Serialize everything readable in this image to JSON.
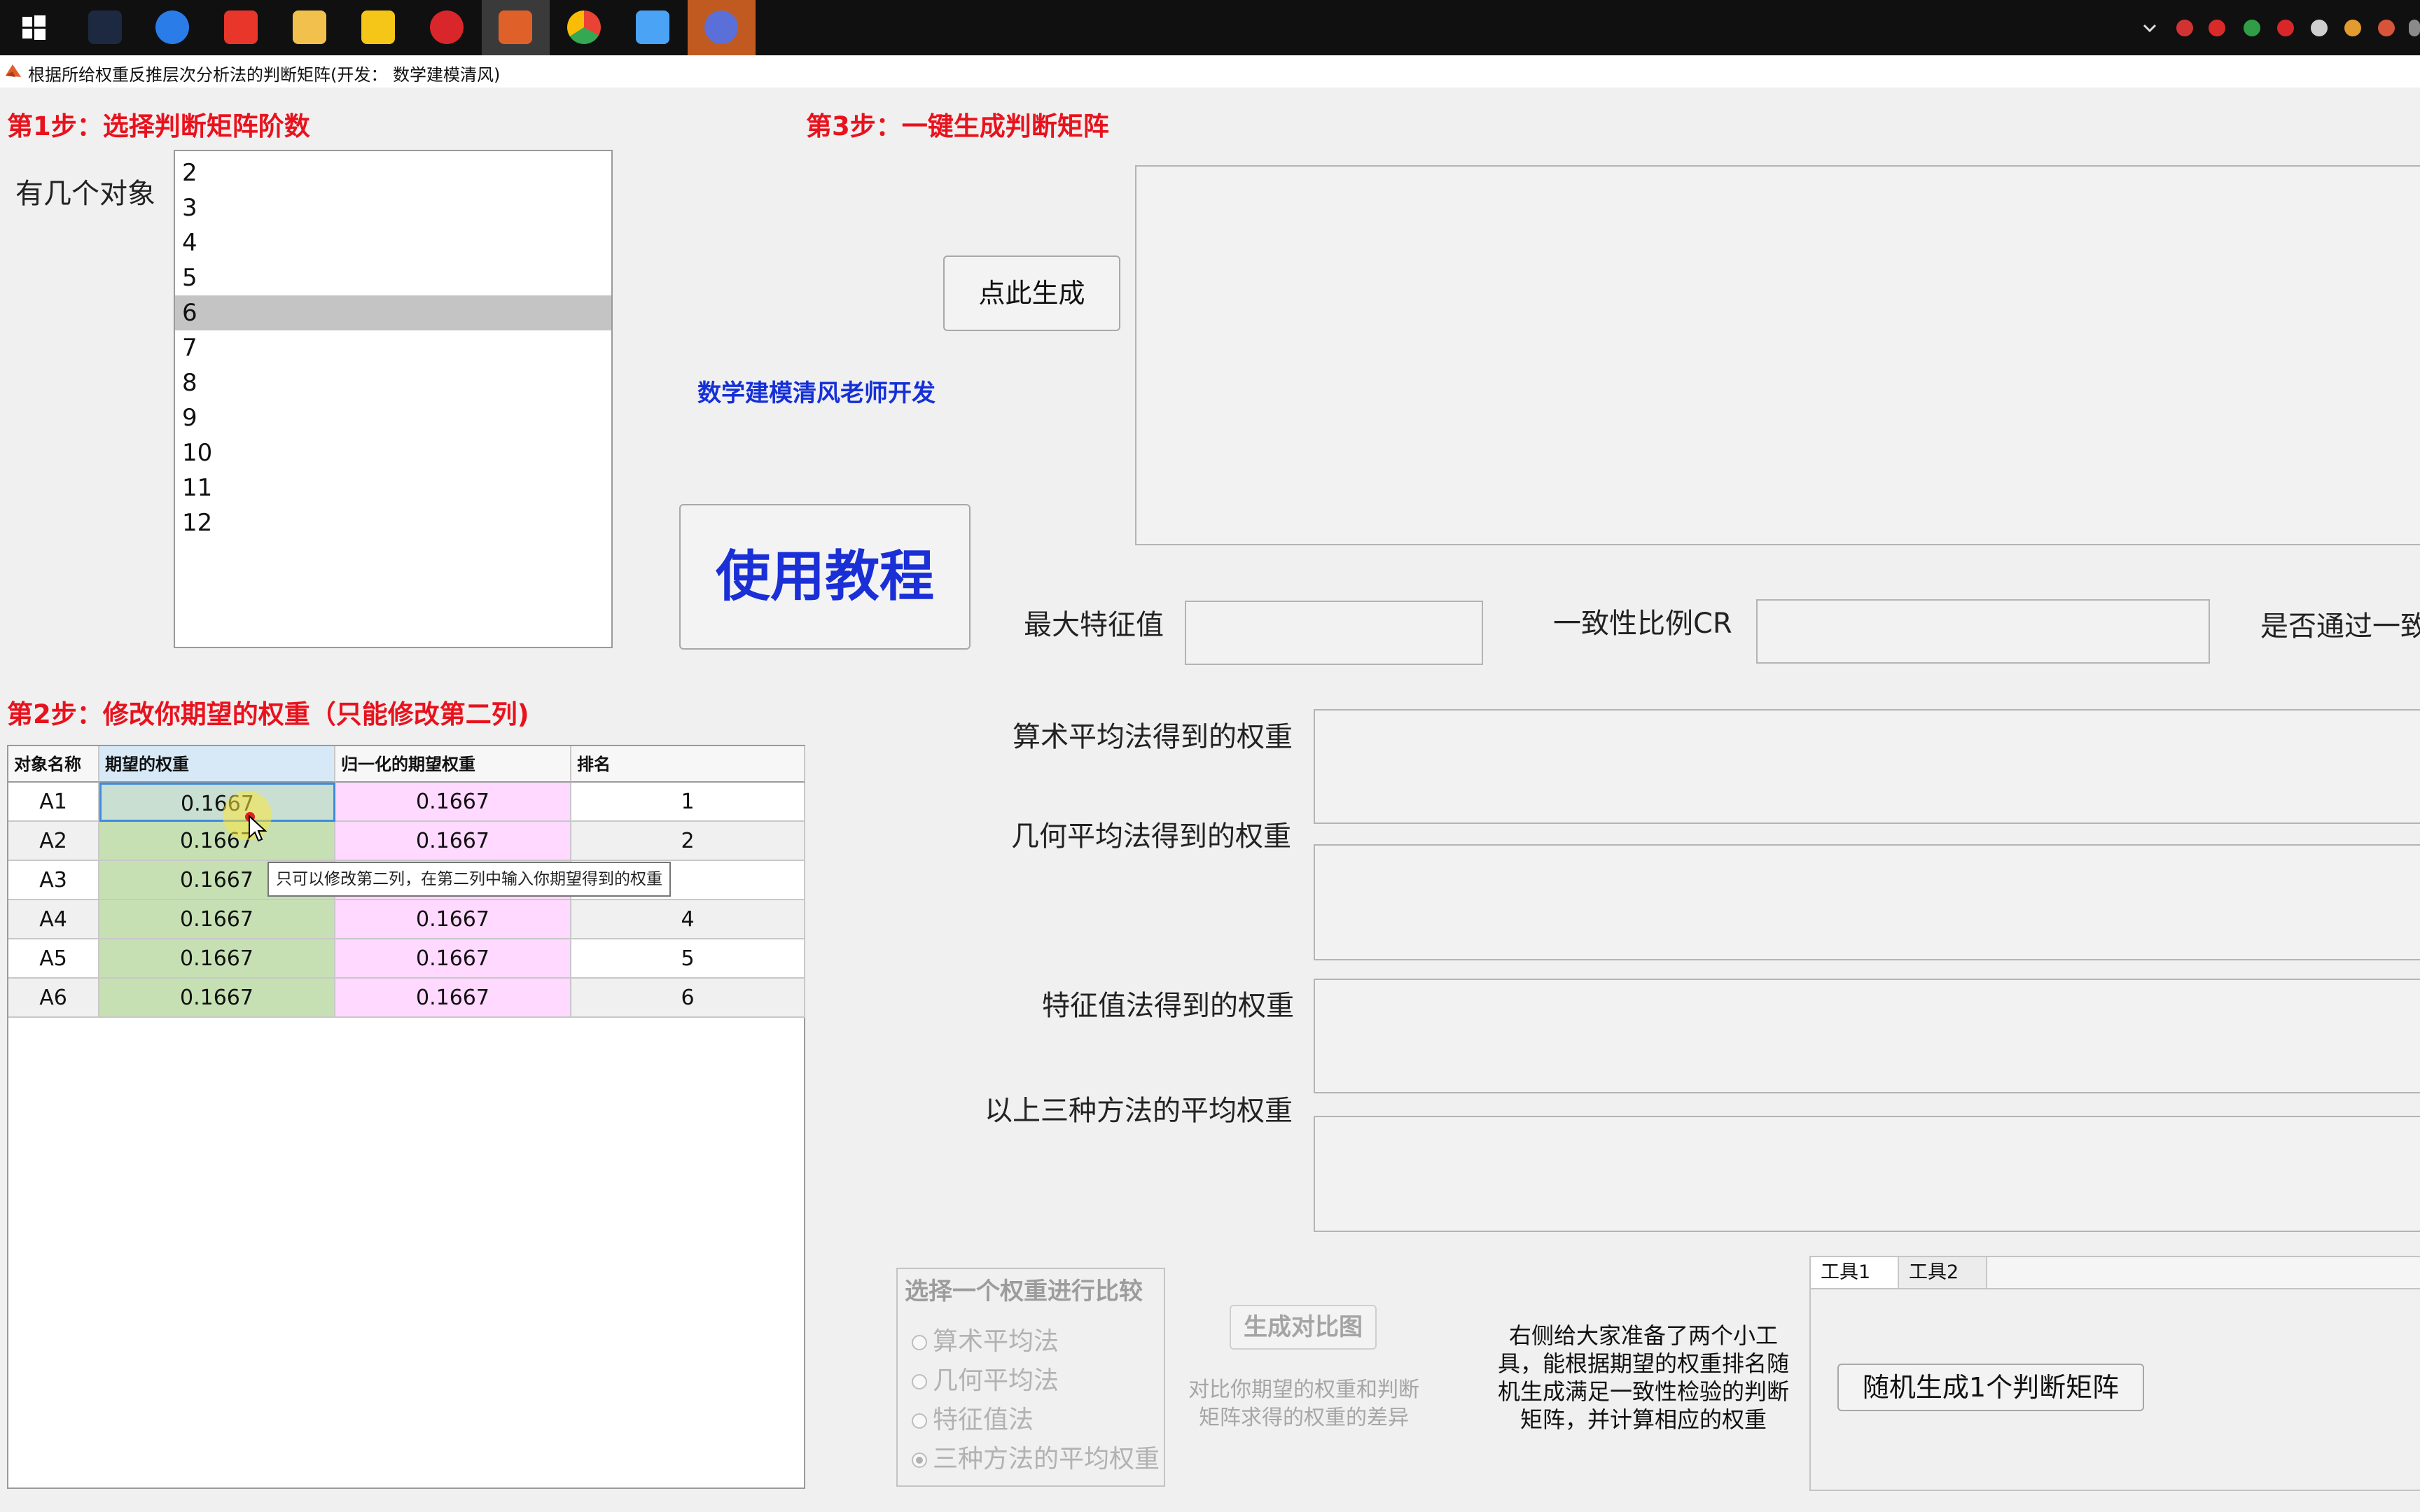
{
  "window": {
    "title": "根据所给权重反推层次分析法的判断矩阵(开发： 数学建模清风)"
  },
  "taskbar": {
    "apps": [
      "start-icon",
      "game-icon",
      "sogou-input-icon",
      "tingshu-app-icon",
      "file-explorer-icon",
      "folder-icon",
      "netease-music-icon",
      "matlab-icon",
      "chrome-icon",
      "baidu-netdisk-icon",
      "app-icon"
    ]
  },
  "step1": {
    "title": "第1步：选择判断矩阵阶数",
    "count_label": "有几个对象",
    "options": [
      "2",
      "3",
      "4",
      "5",
      "6",
      "7",
      "8",
      "9",
      "10",
      "11",
      "12"
    ],
    "selected": "6"
  },
  "step2": {
    "title": "第2步：修改你期望的权重（只能修改第二列)",
    "columns": [
      "对象名称",
      "期望的权重",
      "归一化的期望权重",
      "排名"
    ],
    "rows": [
      {
        "name": "A1",
        "weight": "0.1667",
        "normalized": "0.1667",
        "rank": "1"
      },
      {
        "name": "A2",
        "weight": "0.1667",
        "normalized": "0.1667",
        "rank": "2"
      },
      {
        "name": "A3",
        "weight": "0.1667",
        "normalized": "",
        "rank": ""
      },
      {
        "name": "A4",
        "weight": "0.1667",
        "normalized": "0.1667",
        "rank": "4"
      },
      {
        "name": "A5",
        "weight": "0.1667",
        "normalized": "0.1667",
        "rank": "5"
      },
      {
        "name": "A6",
        "weight": "0.1667",
        "normalized": "0.1667",
        "rank": "6"
      }
    ],
    "tooltip": "只可以修改第二列，在第二列中输入你期望得到的权重"
  },
  "step3": {
    "title": "第3步：一键生成判断矩阵",
    "generate_button": "点此生成",
    "developer_credit": "数学建模清风老师开发",
    "tutorial_button": "使用教程",
    "max_eigen_label": "最大特征值",
    "cr_label": "一致性比例CR",
    "pass_label": "是否通过一致"
  },
  "weights": {
    "arith_label": "算术平均法得到的权重",
    "geo_label": "几何平均法得到的权重",
    "eigen_label": "特征值法得到的权重",
    "avg_label": "以上三种方法的平均权重"
  },
  "compare": {
    "group_title": "选择一个权重进行比较",
    "options": [
      "算术平均法",
      "几何平均法",
      "特征值法",
      "三种方法的平均权重"
    ],
    "selected_index": 3,
    "button": "生成对比图",
    "note": "对比你期望的权重和判断矩阵求得的权重的差异"
  },
  "tools": {
    "intro": "右侧给大家准备了两个小工具，能根据期望的权重排名随机生成满足一致性检验的判断矩阵，并计算相应的权重",
    "tabs": [
      "工具1",
      "工具2"
    ],
    "random_button": "随机生成1个判断矩阵"
  },
  "colors": {
    "step_title": "#e8121d",
    "credit_blue": "#1530d8",
    "tutorial_blue": "#1a2fd6",
    "weight_cell": "#c6e0b4",
    "normalized_cell": "#ffd9ff",
    "taskbar": "#101010"
  }
}
